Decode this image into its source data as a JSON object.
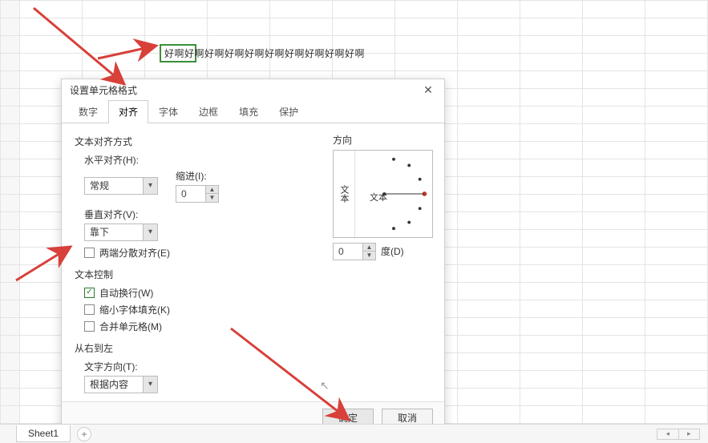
{
  "cell_text": "好啊好啊好啊好啊好啊好啊好啊好啊好啊好啊",
  "dialog": {
    "title": "设置单元格格式",
    "tabs": [
      "数字",
      "对齐",
      "字体",
      "边框",
      "填充",
      "保护"
    ],
    "active_tab_index": 1,
    "alignment": {
      "section_title": "文本对齐方式",
      "horizontal_label": "水平对齐(H):",
      "horizontal_value": "常规",
      "indent_label": "缩进(I):",
      "indent_value": "0",
      "vertical_label": "垂直对齐(V):",
      "vertical_value": "靠下",
      "justify_distributed_label": "两端分散对齐(E)",
      "justify_distributed_checked": false
    },
    "text_control": {
      "section_title": "文本控制",
      "wrap_label": "自动换行(W)",
      "wrap_checked": true,
      "shrink_label": "缩小字体填充(K)",
      "shrink_checked": false,
      "merge_label": "合并单元格(M)",
      "merge_checked": false
    },
    "rtl": {
      "section_title": "从右到左",
      "direction_label": "文字方向(T):",
      "direction_value": "根据内容"
    },
    "orientation": {
      "label": "方向",
      "vertical_text": "文本",
      "center_text": "文本",
      "degree_value": "0",
      "degree_label": "度(D)"
    },
    "buttons": {
      "ok": "确定",
      "cancel": "取消"
    }
  },
  "sheet": {
    "tab_name": "Sheet1"
  }
}
